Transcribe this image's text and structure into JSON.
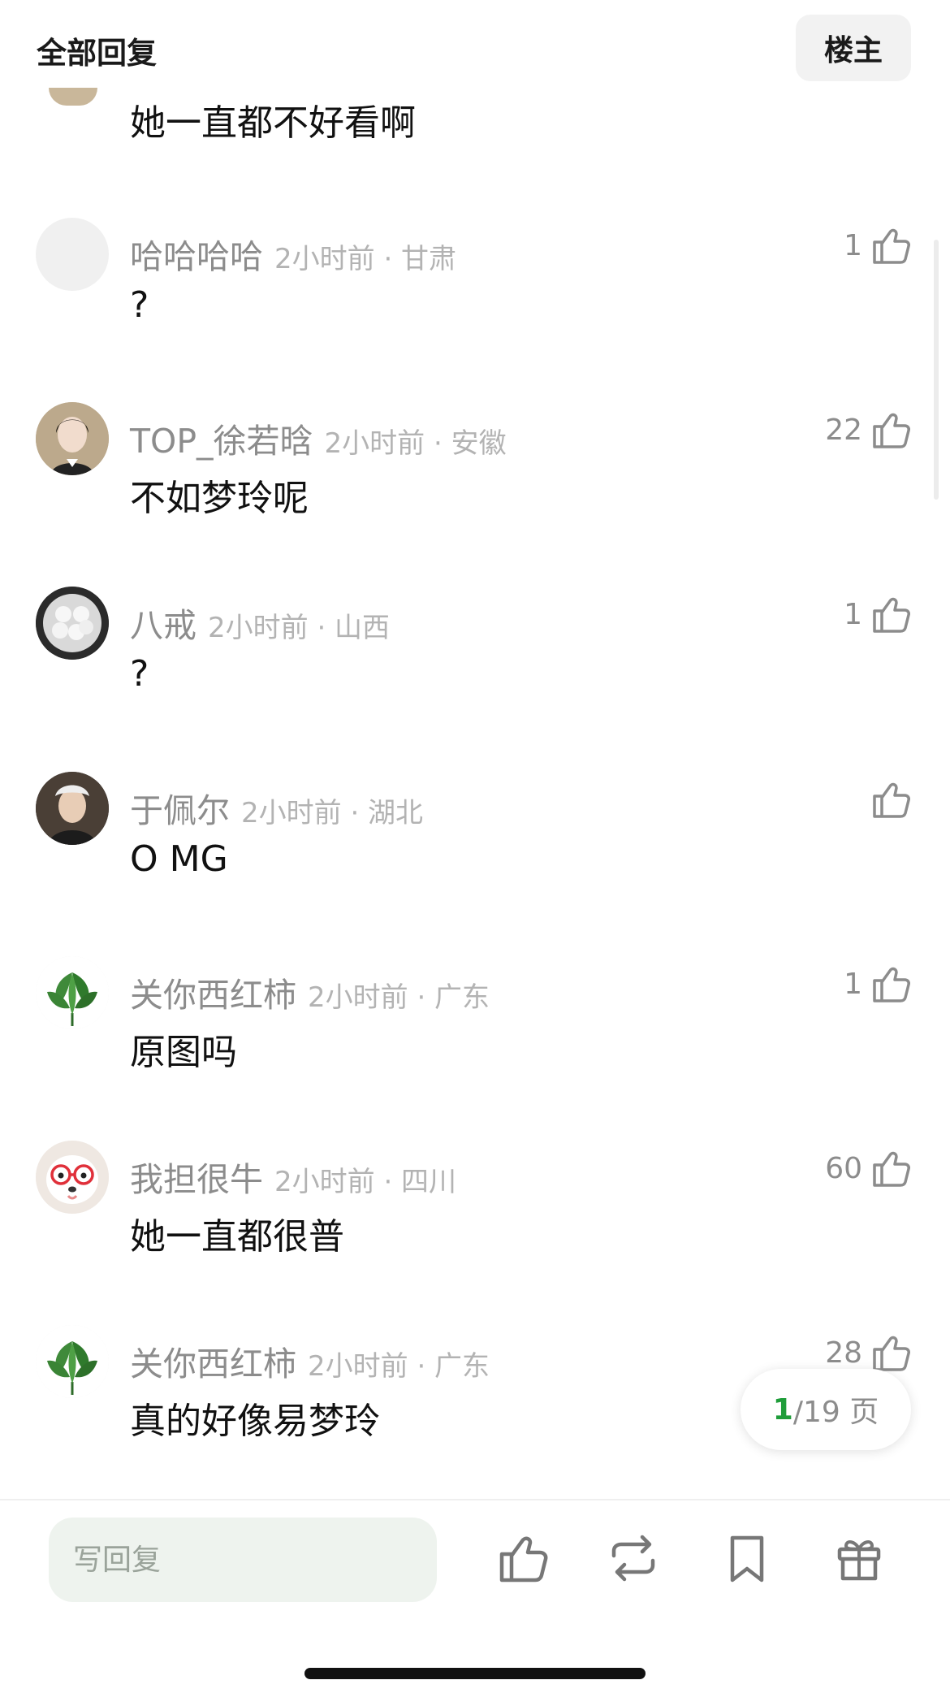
{
  "header": {
    "title": "全部回复",
    "op_label": "楼主"
  },
  "partial_comment": {
    "text": "她一直都不好看啊"
  },
  "comments": [
    {
      "username": "哈哈哈哈",
      "meta": "2小时前 · 甘肃",
      "likes": "1",
      "text": "?",
      "avatar": "blank-avatar"
    },
    {
      "username": "TOP_徐若晗",
      "meta": "2小时前 · 安徽",
      "likes": "22",
      "text": "不如梦玲呢",
      "avatar": "portrait-avatar"
    },
    {
      "username": "八戒",
      "meta": "2小时前 · 山西",
      "likes": "1",
      "text": "?",
      "avatar": "dumplings-avatar"
    },
    {
      "username": "于佩尔",
      "meta": "2小时前 · 湖北",
      "likes": "",
      "text": "O MG",
      "avatar": "portrait-avatar"
    },
    {
      "username": "关你西红柿",
      "meta": "2小时前 · 广东",
      "likes": "1",
      "text": "原图吗",
      "avatar": "leaf-avatar"
    },
    {
      "username": "我担很牛",
      "meta": "2小时前 · 四川",
      "likes": "60",
      "text": "她一直都很普",
      "avatar": "dog-glasses-avatar"
    },
    {
      "username": "关你西红柿",
      "meta": "2小时前 · 广东",
      "likes": "28",
      "text": "真的好像易梦玲",
      "avatar": "leaf-avatar"
    }
  ],
  "pager": {
    "current": "1",
    "total": "/19 页"
  },
  "bottom_bar": {
    "reply_placeholder": "写回复",
    "icons": [
      "thumbs-up-icon",
      "repost-icon",
      "bookmark-icon",
      "gift-icon"
    ]
  },
  "colors": {
    "accent_green": "#1f9d3a",
    "input_bg": "#eef3ee",
    "meta_gray": "#b3b3b3",
    "name_gray": "#8c8c8c"
  }
}
